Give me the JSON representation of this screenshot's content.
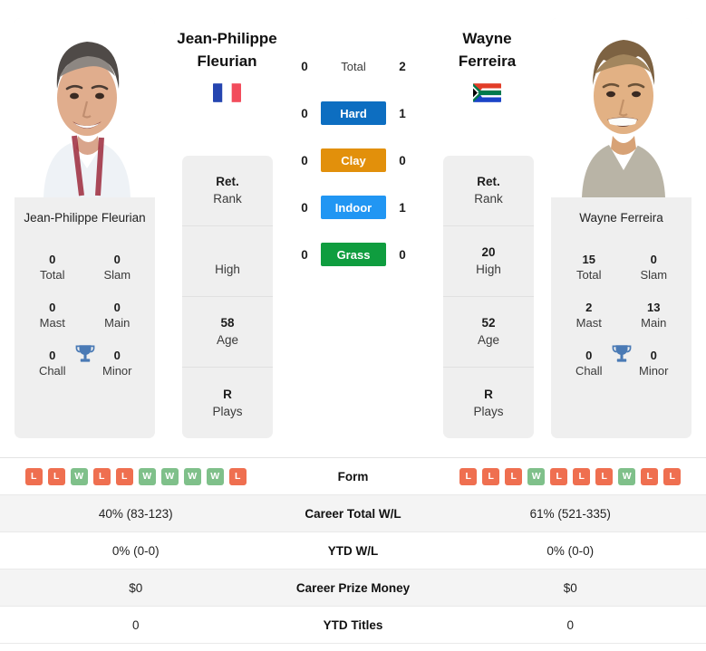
{
  "colors": {
    "hard": "#0d6ec1",
    "clay": "#e2900b",
    "indoor": "#2196f3",
    "grass": "#0f9d3f",
    "win": "#7fc08a",
    "loss": "#ef6f50",
    "trophy": "#4a7ab5",
    "card_bg": "#efefef"
  },
  "players": {
    "left": {
      "header_name_line1": "Jean-Philippe",
      "header_name_line2": "Fleurian",
      "country": "France",
      "flag": "fr-flag-icon",
      "card_name": "Jean-Philippe Fleurian",
      "titles": [
        {
          "value": "0",
          "label": "Total"
        },
        {
          "value": "0",
          "label": "Slam"
        },
        {
          "value": "0",
          "label": "Mast"
        },
        {
          "value": "0",
          "label": "Main"
        },
        {
          "value": "0",
          "label": "Chall"
        },
        {
          "value": "0",
          "label": "Minor"
        }
      ],
      "strip": [
        {
          "value": "Ret.",
          "label": "Rank"
        },
        {
          "value": "",
          "label": "High"
        },
        {
          "value": "58",
          "label": "Age"
        },
        {
          "value": "R",
          "label": "Plays"
        }
      ],
      "form": [
        "L",
        "L",
        "W",
        "L",
        "L",
        "W",
        "W",
        "W",
        "W",
        "L"
      ],
      "career_total_wl": "40% (83-123)",
      "ytd_wl": "0% (0-0)",
      "career_prize_money": "$0",
      "ytd_titles": "0"
    },
    "right": {
      "header_name_line1": "Wayne",
      "header_name_line2": "Ferreira",
      "country": "South Africa",
      "flag": "za-flag-icon",
      "card_name": "Wayne Ferreira",
      "titles": [
        {
          "value": "15",
          "label": "Total"
        },
        {
          "value": "0",
          "label": "Slam"
        },
        {
          "value": "2",
          "label": "Mast"
        },
        {
          "value": "13",
          "label": "Main"
        },
        {
          "value": "0",
          "label": "Chall"
        },
        {
          "value": "0",
          "label": "Minor"
        }
      ],
      "strip": [
        {
          "value": "Ret.",
          "label": "Rank"
        },
        {
          "value": "20",
          "label": "High"
        },
        {
          "value": "52",
          "label": "Age"
        },
        {
          "value": "R",
          "label": "Plays"
        }
      ],
      "form": [
        "L",
        "L",
        "L",
        "W",
        "L",
        "L",
        "L",
        "W",
        "L",
        "L"
      ],
      "career_total_wl": "61% (521-335)",
      "ytd_wl": "0% (0-0)",
      "career_prize_money": "$0",
      "ytd_titles": "0"
    }
  },
  "head_to_head": [
    {
      "label": "Total",
      "left": "0",
      "right": "2",
      "style": "plain",
      "color": ""
    },
    {
      "label": "Hard",
      "left": "0",
      "right": "1",
      "style": "filled",
      "color": "#0d6ec1"
    },
    {
      "label": "Clay",
      "left": "0",
      "right": "0",
      "style": "filled",
      "color": "#e2900b"
    },
    {
      "label": "Indoor",
      "left": "0",
      "right": "1",
      "style": "filled",
      "color": "#2196f3"
    },
    {
      "label": "Grass",
      "left": "0",
      "right": "0",
      "style": "filled",
      "color": "#0f9d3f"
    }
  ],
  "table": {
    "rows": [
      {
        "label": "Form",
        "type": "form"
      },
      {
        "label": "Career Total W/L",
        "type": "text",
        "key": "career_total_wl"
      },
      {
        "label": "YTD W/L",
        "type": "text",
        "key": "ytd_wl"
      },
      {
        "label": "Career Prize Money",
        "type": "text",
        "key": "career_prize_money"
      },
      {
        "label": "YTD Titles",
        "type": "text",
        "key": "ytd_titles"
      }
    ]
  }
}
